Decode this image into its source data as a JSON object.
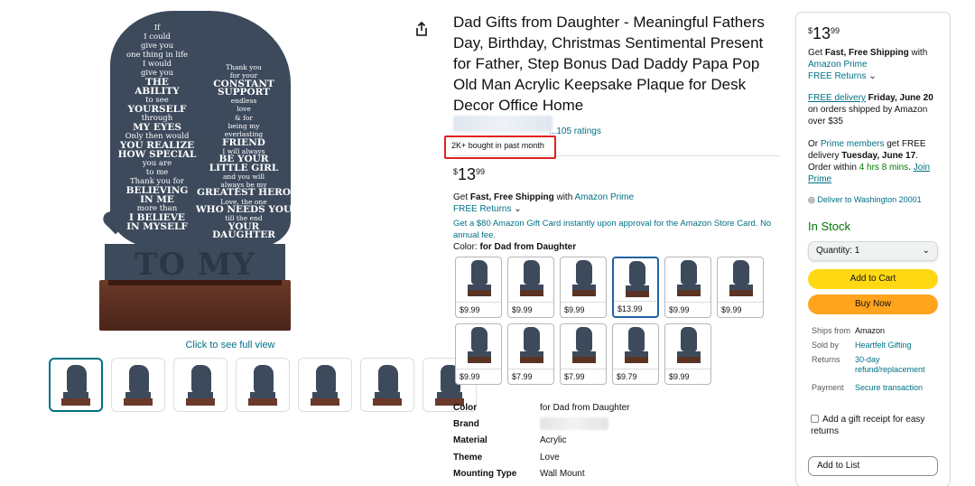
{
  "product": {
    "title": "Dad Gifts from Daughter - Meaningful Fathers Day, Birthday, Christmas Sentimental Present for Father, Step Bonus Dad Daddy Papa Pop Old Man Acrylic Keepsake Plaque for Desk Decor Office Home",
    "ratings_fragment": "...105 ratings",
    "bought_badge": "2K+ bought in past month",
    "price_symbol": "$",
    "price_whole": "13",
    "price_fraction": "99",
    "shipping_prefix": "Get ",
    "shipping_bold": "Fast, Free Shipping",
    "shipping_with": " with ",
    "shipping_link": "Amazon Prime",
    "free_returns": "FREE Returns",
    "gift_card_offer": "Get a $80 Amazon Gift Card instantly upon approval for the Amazon Store Card. No annual fee.",
    "color_label": "Color: ",
    "color_value": "for Dad from Daughter"
  },
  "gallery": {
    "full_view": "Click to see full view",
    "plaque_text": {
      "left_column": [
        "If",
        "I could",
        "give you",
        "one thing in life",
        "I would",
        "give you",
        "THE",
        "ABILITY",
        "to see",
        "YOURSELF",
        "through",
        "MY EYES",
        "Only then would",
        "YOU REALIZE",
        "HOW SPECIAL",
        "you are",
        "to me",
        "Thank you for",
        "BELIEVING",
        "IN ME",
        "more than",
        "I BELIEVE",
        "IN MYSELF"
      ],
      "right_column": [
        "Thank you",
        "for your",
        "CONSTANT",
        "SUPPORT",
        "endless",
        "love",
        "& for",
        "being my",
        "everlasting",
        "FRIEND",
        "I will always",
        "BE YOUR",
        "LITTLE GIRL",
        "and you will",
        "always be my",
        "GREATEST HERO",
        "Love, the one",
        "WHO NEEDS YOU",
        "till the end",
        "YOUR",
        "DAUGHTER"
      ],
      "banner": "TO MY DAD"
    },
    "thumb_count": 7
  },
  "variants": [
    {
      "price": "$9.99"
    },
    {
      "price": "$9.99"
    },
    {
      "price": "$9.99"
    },
    {
      "price": "$13.99"
    },
    {
      "price": "$9.99"
    },
    {
      "price": "$9.99"
    },
    {
      "price": "$9.99"
    },
    {
      "price": "$7.99"
    },
    {
      "price": "$7.99"
    },
    {
      "price": "$9.79"
    },
    {
      "price": "$9.99"
    }
  ],
  "selected_variant_index": 3,
  "details": [
    {
      "key": "Color",
      "value": "for Dad from Daughter"
    },
    {
      "key": "Brand",
      "value": ""
    },
    {
      "key": "Material",
      "value": "Acrylic"
    },
    {
      "key": "Theme",
      "value": "Love"
    },
    {
      "key": "Mounting Type",
      "value": "Wall Mount"
    }
  ],
  "buybox": {
    "price_symbol": "$",
    "price_whole": "13",
    "price_fraction": "99",
    "ship_get": "Get ",
    "ship_bold": "Fast, Free Shipping",
    "ship_with": " with",
    "ship_link": "Amazon Prime",
    "free_returns": "FREE Returns",
    "free_delivery_link": "FREE delivery",
    "free_delivery_date": " Friday, June 20",
    "free_delivery_rest": " on orders shipped by Amazon over $35",
    "or_text": "Or ",
    "prime_members": "Prime members",
    "get_free": " get FREE delivery ",
    "prime_date": "Tuesday, June 17",
    "order_within": ". Order within ",
    "countdown": "4 hrs 8 mins",
    "join_prime": "Join Prime",
    "deliver_to": "Deliver to Washington 20001",
    "in_stock": "In Stock",
    "quantity": "Quantity: 1",
    "add_to_cart": "Add to Cart",
    "buy_now": "Buy Now",
    "ships_from_key": "Ships from",
    "ships_from_val": "Amazon",
    "sold_by_key": "Sold by",
    "sold_by_val": "Heartfelt Gifting",
    "returns_key": "Returns",
    "returns_val": "30-day refund/replacement",
    "payment_key": "Payment",
    "payment_val": "Secure transaction",
    "gift_receipt": "Add a gift receipt for easy returns",
    "add_to_list": "Add to List"
  },
  "colors": {
    "link": "#007185",
    "in_stock": "#007600",
    "add_to_cart": "#ffd814",
    "buy_now": "#ffa41c",
    "highlight_box": "#e02020",
    "plaque": "#3d4a5c",
    "base_wood": "#6b3a2a"
  }
}
